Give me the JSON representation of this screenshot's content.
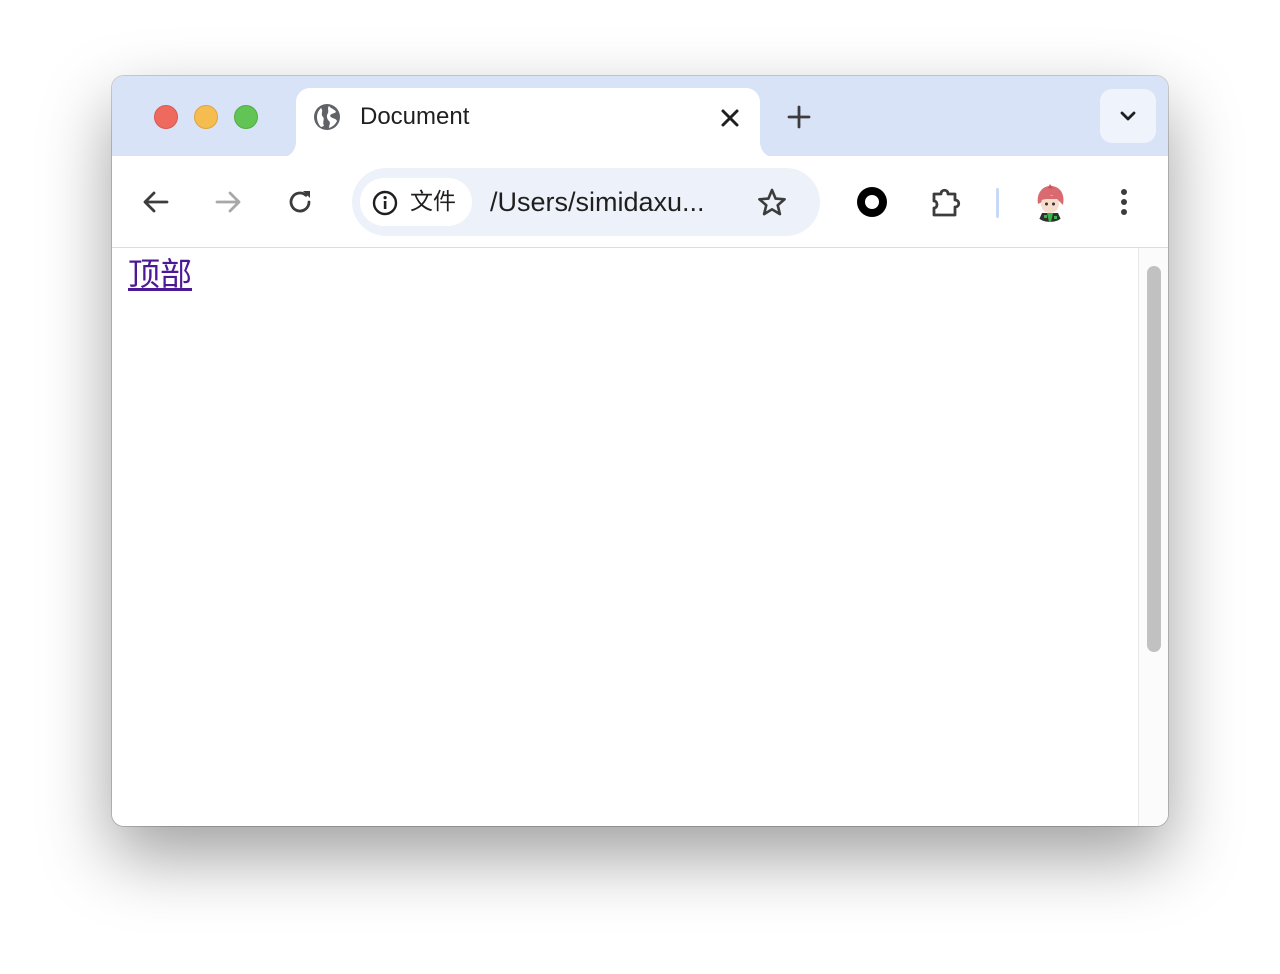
{
  "window": {
    "controls": [
      "close",
      "minimize",
      "maximize"
    ]
  },
  "tabs": [
    {
      "title": "Document",
      "favicon": "globe-icon",
      "active": true
    }
  ],
  "toolbar": {
    "back_icon": "back-arrow-icon",
    "forward_icon": "forward-arrow-icon",
    "reload_icon": "reload-icon",
    "site_chip_label": "文件",
    "site_chip_icon": "info-icon",
    "url": "/Users/simidaxu...",
    "bookmark_icon": "star-icon",
    "extensions": [
      "record-extension-icon",
      "puzzle-icon"
    ],
    "profile": "avatar",
    "menu_icon": "more-vert-icon"
  },
  "page": {
    "link_text": "顶部"
  },
  "colors": {
    "titlebar": "#d9e3f8",
    "omnibox": "#edf2fa",
    "visited_link": "#4b1996"
  }
}
